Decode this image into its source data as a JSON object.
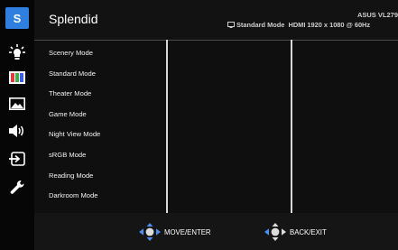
{
  "header": {
    "title": "Splendid",
    "status_text": "Standard Mode  HDMI 1920 x 1080 @ 60Hz",
    "model": "ASUS VL279"
  },
  "sidebar": {
    "items": [
      {
        "name": "splendid",
        "glyph": "S",
        "active": true
      },
      {
        "name": "blue-light-filter",
        "glyph": "✱"
      },
      {
        "name": "color",
        "glyph": "▥"
      },
      {
        "name": "image",
        "glyph": "▣"
      },
      {
        "name": "sound",
        "glyph": "◀))"
      },
      {
        "name": "input-select",
        "glyph": "⎆"
      },
      {
        "name": "system-setup",
        "glyph": "✎"
      }
    ]
  },
  "menu": {
    "items": [
      "Scenery Mode",
      "Standard Mode",
      "Theater Mode",
      "Game Mode",
      "Night View Mode",
      "sRGB Mode",
      "Reading Mode",
      "Darkroom Mode"
    ]
  },
  "footer": {
    "move_label": "MOVE/ENTER",
    "back_label": "BACK/EXIT"
  },
  "colors": {
    "accent": "#2e7fe0",
    "icon_color": "#4a8ff0"
  }
}
